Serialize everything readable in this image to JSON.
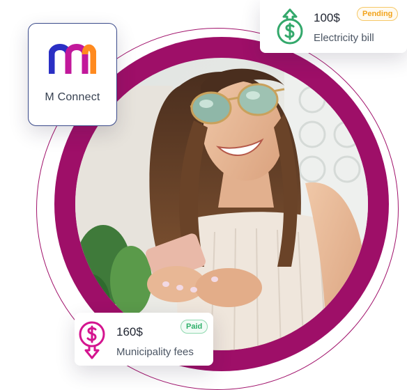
{
  "app": {
    "name": "M Connect",
    "logo_icon": "m-connect-logo",
    "logo_colors": [
      "#2a2fc4",
      "#c2189b",
      "#ff8a1f"
    ]
  },
  "bills": [
    {
      "amount": "100$",
      "description": "Electricity bill",
      "status": "Pending",
      "status_color": "#f2a31b",
      "icon": "dollar-up-arrow-icon",
      "icon_color": "#33a86b"
    },
    {
      "amount": "160$",
      "description": "Municipality fees",
      "status": "Paid",
      "status_color": "#2fb06a",
      "icon": "dollar-down-arrow-icon",
      "icon_color": "#d4148f"
    }
  ],
  "theme": {
    "ring_color": "#9e0f68"
  }
}
